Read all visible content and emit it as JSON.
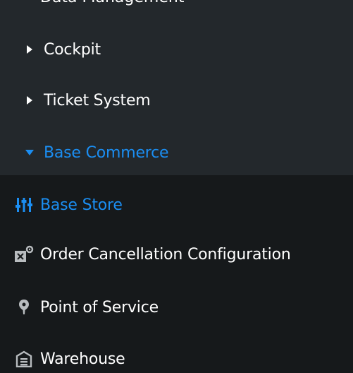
{
  "top_partial_label": "Data Management",
  "groups": [
    {
      "label": "Cockpit",
      "expanded": false,
      "icon": "caret-right-icon"
    },
    {
      "label": "Ticket System",
      "expanded": false,
      "icon": "caret-right-icon"
    },
    {
      "label": "Base Commerce",
      "expanded": true,
      "icon": "caret-down-icon"
    }
  ],
  "items": [
    {
      "label": "Base Store",
      "icon": "sliders-icon",
      "active": true
    },
    {
      "label": "Order Cancellation Configuration",
      "icon": "document-gear-icon",
      "active": false
    },
    {
      "label": "Point of Service",
      "icon": "map-pin-icon",
      "active": false
    },
    {
      "label": "Warehouse",
      "icon": "warehouse-icon",
      "active": false
    }
  ],
  "colors": {
    "accent": "#1b8ef2",
    "upper_bg": "#23282c",
    "lower_bg": "#16191b",
    "text": "#ffffff",
    "icon_gray": "#b8bcbf"
  }
}
